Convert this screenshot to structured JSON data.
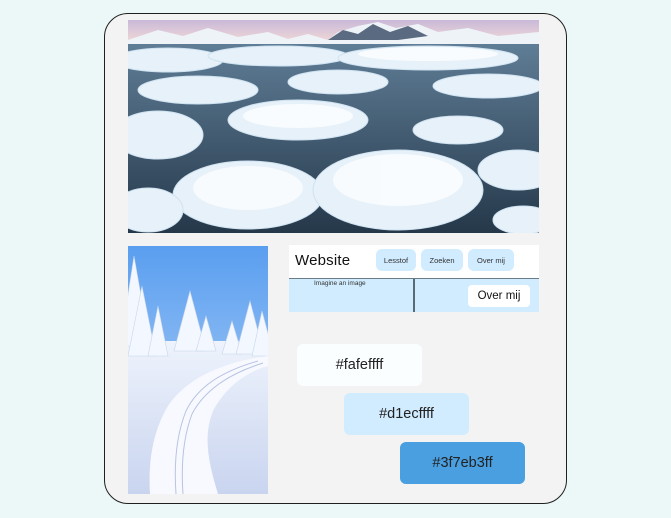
{
  "website": {
    "title": "Website",
    "nav": [
      "Lesstof",
      "Zoeken",
      "Over mij"
    ],
    "caption": "Imagine an image",
    "button": "Over mij"
  },
  "swatches": [
    {
      "label": "#fafeffff",
      "color": "#fafeff"
    },
    {
      "label": "#d1ecffff",
      "color": "#d1ecff"
    },
    {
      "label": "#3f7eb3ff",
      "color": "#4a9fe0"
    }
  ]
}
